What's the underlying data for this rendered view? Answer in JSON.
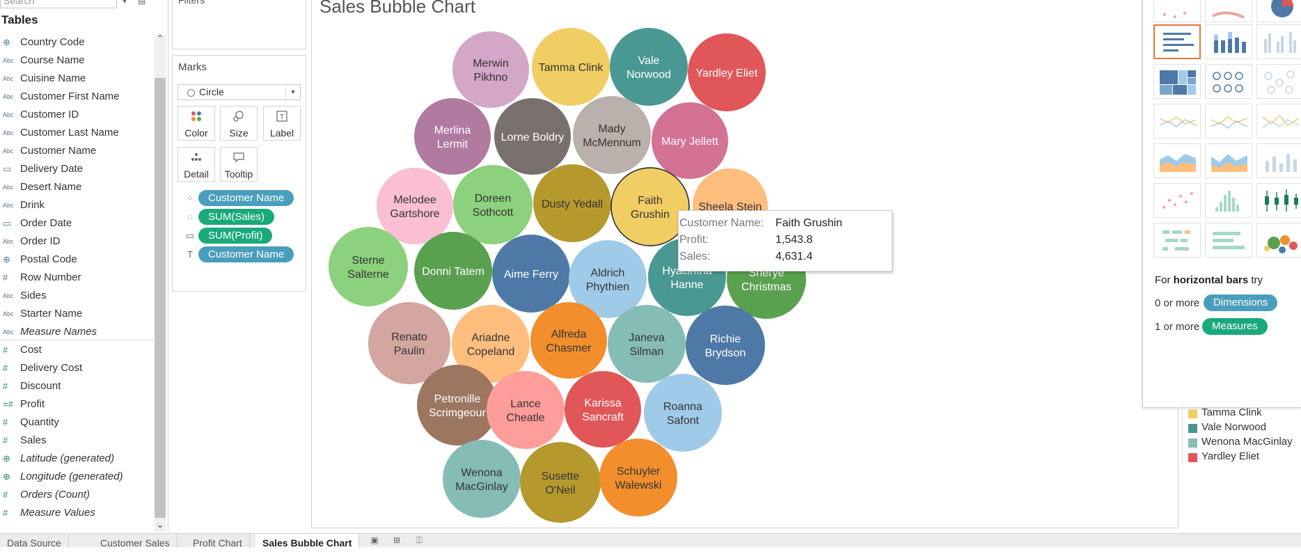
{
  "data_pane": {
    "search_placeholder": "Search",
    "tables_title": "Tables",
    "dimensions": [
      {
        "name": "Country Code",
        "type": "geo",
        "italic": false
      },
      {
        "name": "Course Name",
        "type": "abc",
        "italic": false
      },
      {
        "name": "Cuisine Name",
        "type": "abc",
        "italic": false
      },
      {
        "name": "Customer First Name",
        "type": "abc",
        "italic": false
      },
      {
        "name": "Customer ID",
        "type": "abc",
        "italic": false
      },
      {
        "name": "Customer Last Name",
        "type": "abc",
        "italic": false
      },
      {
        "name": "Customer Name",
        "type": "abc",
        "italic": false
      },
      {
        "name": "Delivery Date",
        "type": "date",
        "italic": false
      },
      {
        "name": "Desert Name",
        "type": "abc",
        "italic": false
      },
      {
        "name": "Drink",
        "type": "abc",
        "italic": false
      },
      {
        "name": "Order Date",
        "type": "date",
        "italic": false
      },
      {
        "name": "Order ID",
        "type": "abc",
        "italic": false
      },
      {
        "name": "Postal Code",
        "type": "geo",
        "italic": false
      },
      {
        "name": "Row Number",
        "type": "num",
        "italic": false
      },
      {
        "name": "Sides",
        "type": "abc",
        "italic": false
      },
      {
        "name": "Starter Name",
        "type": "abc",
        "italic": false
      },
      {
        "name": "Measure Names",
        "type": "abc",
        "italic": true
      }
    ],
    "measures": [
      {
        "name": "Cost",
        "type": "num",
        "italic": false
      },
      {
        "name": "Delivery Cost",
        "type": "num",
        "italic": false
      },
      {
        "name": "Discount",
        "type": "num",
        "italic": false
      },
      {
        "name": "Profit",
        "type": "num",
        "italic": false
      },
      {
        "name": "Quantity",
        "type": "num",
        "italic": false
      },
      {
        "name": "Sales",
        "type": "num",
        "italic": false
      },
      {
        "name": "Latitude (generated)",
        "type": "geo",
        "italic": true
      },
      {
        "name": "Longitude (generated)",
        "type": "geo",
        "italic": true
      },
      {
        "name": "Orders (Count)",
        "type": "num",
        "italic": true
      },
      {
        "name": "Measure Values",
        "type": "num",
        "italic": true
      }
    ]
  },
  "filters": {
    "label": "Filters"
  },
  "marks": {
    "label": "Marks",
    "mark_type": "Circle",
    "buttons": [
      "Color",
      "Size",
      "Label",
      "Detail",
      "Tooltip"
    ],
    "pills": [
      {
        "icon": "color-icon",
        "label": "Customer Name",
        "kind": "dim"
      },
      {
        "icon": "size-icon",
        "label": "SUM(Sales)",
        "kind": "mea"
      },
      {
        "icon": "tooltip-icon",
        "label": "SUM(Profit)",
        "kind": "mea"
      },
      {
        "icon": "label-icon",
        "label": "Customer Name",
        "kind": "dim"
      }
    ]
  },
  "view": {
    "title": "Sales Bubble Chart",
    "bubbles": [
      {
        "label": [
          "Merwin",
          "Pikhno"
        ],
        "color": "#d4a6c8",
        "text": "#333"
      },
      {
        "label": [
          "Tamma Clink"
        ],
        "color": "#f1ce63",
        "text": "#333"
      },
      {
        "label": [
          "Vale",
          "Norwood"
        ],
        "color": "#499894",
        "text": "#fff"
      },
      {
        "label": [
          "Yardley Eliet"
        ],
        "color": "#e15759",
        "text": "#fff"
      },
      {
        "label": [
          "Merlina",
          "Lermit"
        ],
        "color": "#b07aa1",
        "text": "#fff"
      },
      {
        "label": [
          "Lorne Boldry"
        ],
        "color": "#79706e",
        "text": "#fff"
      },
      {
        "label": [
          "Mady",
          "McMennum"
        ],
        "color": "#bab0ac",
        "text": "#333"
      },
      {
        "label": [
          "Mary Jellett"
        ],
        "color": "#d37295",
        "text": "#fff"
      },
      {
        "label": [
          "Melodee",
          "Gartshore"
        ],
        "color": "#fabfd2",
        "text": "#333"
      },
      {
        "label": [
          "Doreen",
          "Sothcott"
        ],
        "color": "#8cd17d",
        "text": "#333"
      },
      {
        "label": [
          "Dusty Yedall"
        ],
        "color": "#b6992d",
        "text": "#333"
      },
      {
        "label": [
          "Faith",
          "Grushin"
        ],
        "color": "#f1ce63",
        "text": "#333",
        "selected": true
      },
      {
        "label": [
          "Sheela Stein"
        ],
        "color": "#ffbe7d",
        "text": "#333"
      },
      {
        "label": [
          "Sterne",
          "Salterne"
        ],
        "color": "#8cd17d",
        "text": "#333"
      },
      {
        "label": [
          "Donni Tatem"
        ],
        "color": "#59a14f",
        "text": "#fff"
      },
      {
        "label": [
          "Aime Ferry"
        ],
        "color": "#4e79a7",
        "text": "#fff"
      },
      {
        "label": [
          "Aldrich",
          "Phythien"
        ],
        "color": "#a0cbe8",
        "text": "#333"
      },
      {
        "label": [
          "Hyacintha",
          "Hanne"
        ],
        "color": "#499894",
        "text": "#fff"
      },
      {
        "label": [
          "Sherye",
          "Christmas"
        ],
        "color": "#59a14f",
        "text": "#fff"
      },
      {
        "label": [
          "Renato",
          "Paulin"
        ],
        "color": "#d4a6a0",
        "text": "#333"
      },
      {
        "label": [
          "Ariadne",
          "Copeland"
        ],
        "color": "#ffbe7d",
        "text": "#333"
      },
      {
        "label": [
          "Alfreda",
          "Chasmer"
        ],
        "color": "#f28e2b",
        "text": "#333"
      },
      {
        "label": [
          "Janeva",
          "Silman"
        ],
        "color": "#86bcb6",
        "text": "#333"
      },
      {
        "label": [
          "Richie",
          "Brydson"
        ],
        "color": "#4e79a7",
        "text": "#fff"
      },
      {
        "label": [
          "Petronille",
          "Scrimgeour"
        ],
        "color": "#9d7660",
        "text": "#fff"
      },
      {
        "label": [
          "Lance",
          "Cheatle"
        ],
        "color": "#ff9d9a",
        "text": "#333"
      },
      {
        "label": [
          "Karissa",
          "Sancraft"
        ],
        "color": "#e15759",
        "text": "#fff"
      },
      {
        "label": [
          "Roanna",
          "Safont"
        ],
        "color": "#a0cbe8",
        "text": "#333"
      },
      {
        "label": [
          "Wenona",
          "MacGinlay"
        ],
        "color": "#86bcb6",
        "text": "#333"
      },
      {
        "label": [
          "Susette",
          "O'Neil"
        ],
        "color": "#b6992d",
        "text": "#333"
      },
      {
        "label": [
          "Schuyler",
          "Walewski"
        ],
        "color": "#f28e2b",
        "text": "#333"
      }
    ],
    "tooltip": {
      "rows": [
        {
          "key": "Customer Name:",
          "value": "Faith Grushin"
        },
        {
          "key": "Profit:",
          "value": "1,543.8"
        },
        {
          "key": "Sales:",
          "value": "4,631.4"
        }
      ]
    }
  },
  "show_me": {
    "hint_prefix": "For ",
    "hint_bold": "horizontal bars",
    "hint_suffix": " try",
    "dim_prefix": "0 or more",
    "dim_label": "Dimensions",
    "mea_prefix": "1 or more",
    "mea_label": "Measures"
  },
  "legend": {
    "items": [
      {
        "label": "Tamma Clink",
        "color": "#f1ce63"
      },
      {
        "label": "Vale Norwood",
        "color": "#499894"
      },
      {
        "label": "Wenona MacGinlay",
        "color": "#86bcb6"
      },
      {
        "label": "Yardley Eliet",
        "color": "#e15759"
      }
    ]
  },
  "tabs": [
    {
      "label": "Data Source",
      "active": false
    },
    {
      "label": "Customer Sales",
      "active": false
    },
    {
      "label": "Profit Chart",
      "active": false
    },
    {
      "label": "Sales Bubble Chart",
      "active": true
    }
  ]
}
